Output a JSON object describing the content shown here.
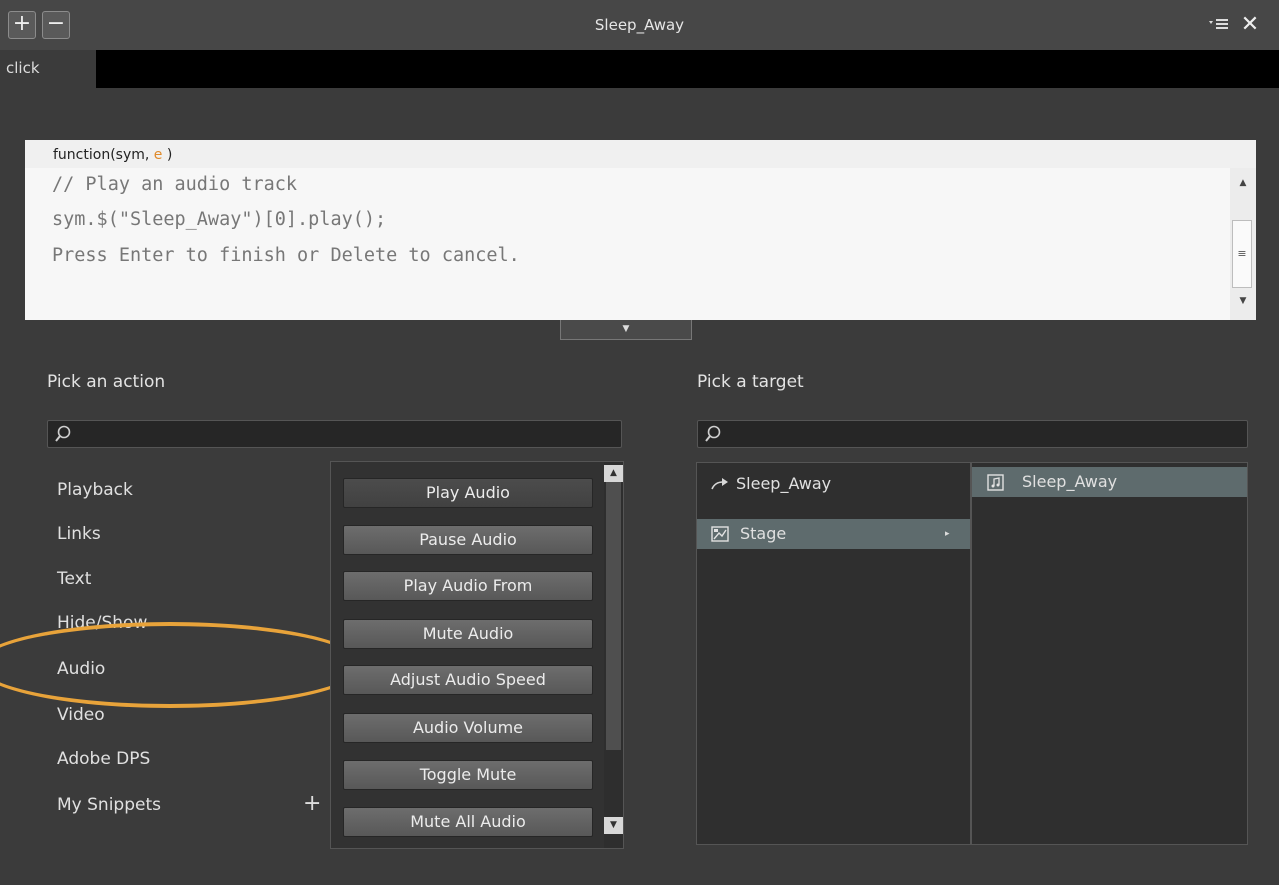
{
  "window": {
    "title": "Sleep_Away",
    "add_button": "+",
    "remove_button": "−",
    "close_symbol": "✕"
  },
  "event_tab": {
    "label": "click"
  },
  "code": {
    "signature_prefix": "function(sym, ",
    "signature_param": "e",
    "signature_suffix": " )",
    "lines": [
      "// Play an audio track",
      "sym.$(\"Sleep_Away\")[0].play();",
      "Press Enter to finish or Delete to cancel."
    ]
  },
  "actions": {
    "heading": "Pick an action",
    "search_placeholder": "",
    "categories": [
      "Playback",
      "Links",
      "Text",
      "Hide/Show",
      "Audio",
      "Video",
      "Adobe DPS",
      "My Snippets"
    ],
    "add_snippet_symbol": "+",
    "items": [
      "Play Audio",
      "Pause Audio",
      "Play Audio From",
      "Mute Audio",
      "Adjust Audio Speed",
      "Audio Volume",
      "Toggle Mute",
      "Mute All Audio"
    ],
    "selected_item": "Play Audio",
    "highlighted_category": "Audio"
  },
  "targets": {
    "heading": "Pick a target",
    "search_placeholder": "",
    "left_items": [
      "Sleep_Away",
      "Stage"
    ],
    "right_items": [
      "Sleep_Away"
    ],
    "selected_left": "Stage"
  },
  "colors": {
    "highlight_ring": "#e8a33a",
    "selection_row": "#5e6b6d",
    "background": "#3b3b3b"
  }
}
